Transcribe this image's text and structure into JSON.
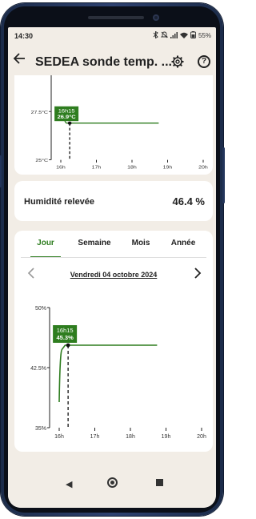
{
  "status_bar": {
    "time": "14:30",
    "battery": "55%",
    "icons": [
      "bluetooth-icon",
      "mute-icon",
      "signal-icon",
      "wifi-icon",
      "battery-icon"
    ]
  },
  "app_bar": {
    "title": "SEDEA sonde temp. ...",
    "back_icon": "back-arrow-icon",
    "settings_icon": "gear-icon",
    "help_icon": "help-icon",
    "help_glyph": "?"
  },
  "temperature_chart": {
    "y_ticks": [
      "27.5°C",
      "25°C"
    ],
    "x_ticks": [
      "16h",
      "17h",
      "18h",
      "19h",
      "20h"
    ],
    "tooltip_time": "16h15",
    "tooltip_value": "26.9°C",
    "accent": "#2e7d1f"
  },
  "humidity_summary": {
    "label": "Humidité relevée",
    "value": "46.4 %"
  },
  "period_tabs": {
    "tabs": [
      "Jour",
      "Semaine",
      "Mois",
      "Année"
    ],
    "active": "Jour"
  },
  "date_nav": {
    "date": "Vendredi 04 octobre 2024",
    "prev_icon": "chevron-left-icon",
    "next_icon": "chevron-right-icon"
  },
  "humidity_chart": {
    "y_ticks": [
      "50%",
      "42.5%",
      "35%"
    ],
    "x_ticks": [
      "16h",
      "17h",
      "18h",
      "19h",
      "20h"
    ],
    "tooltip_time": "16h15",
    "tooltip_value": "45.3%",
    "accent": "#2e7d1f"
  },
  "chart_data": [
    {
      "type": "line",
      "title": "",
      "xlabel": "",
      "ylabel": "",
      "x_ticks": [
        "16h",
        "17h",
        "18h",
        "19h",
        "20h"
      ],
      "y_ticks": [
        "27.5°C",
        "25°C"
      ],
      "series": [
        {
          "x": [
            "16h05",
            "16h10",
            "16h15",
            "18h45"
          ],
          "values": [
            27.4,
            26.9,
            26.9,
            26.9
          ]
        }
      ],
      "highlight": {
        "x": "16h15",
        "value": 26.9
      }
    },
    {
      "type": "line",
      "title": "",
      "xlabel": "",
      "ylabel": "",
      "ylim": [
        35,
        50
      ],
      "x_ticks": [
        "16h",
        "17h",
        "18h",
        "19h",
        "20h"
      ],
      "y_ticks": [
        "50%",
        "42.5%",
        "35%"
      ],
      "series": [
        {
          "x": [
            "16h00",
            "16h05",
            "16h10",
            "16h15",
            "18h45"
          ],
          "values": [
            38.2,
            44.8,
            45.3,
            45.3,
            45.3
          ]
        }
      ],
      "highlight": {
        "x": "16h15",
        "value": 45.3
      }
    }
  ],
  "nav_bar": {
    "back_icon": "nav-back-icon",
    "home_icon": "nav-home-icon",
    "recents_icon": "nav-recents-icon",
    "back_glyph": "◀"
  }
}
